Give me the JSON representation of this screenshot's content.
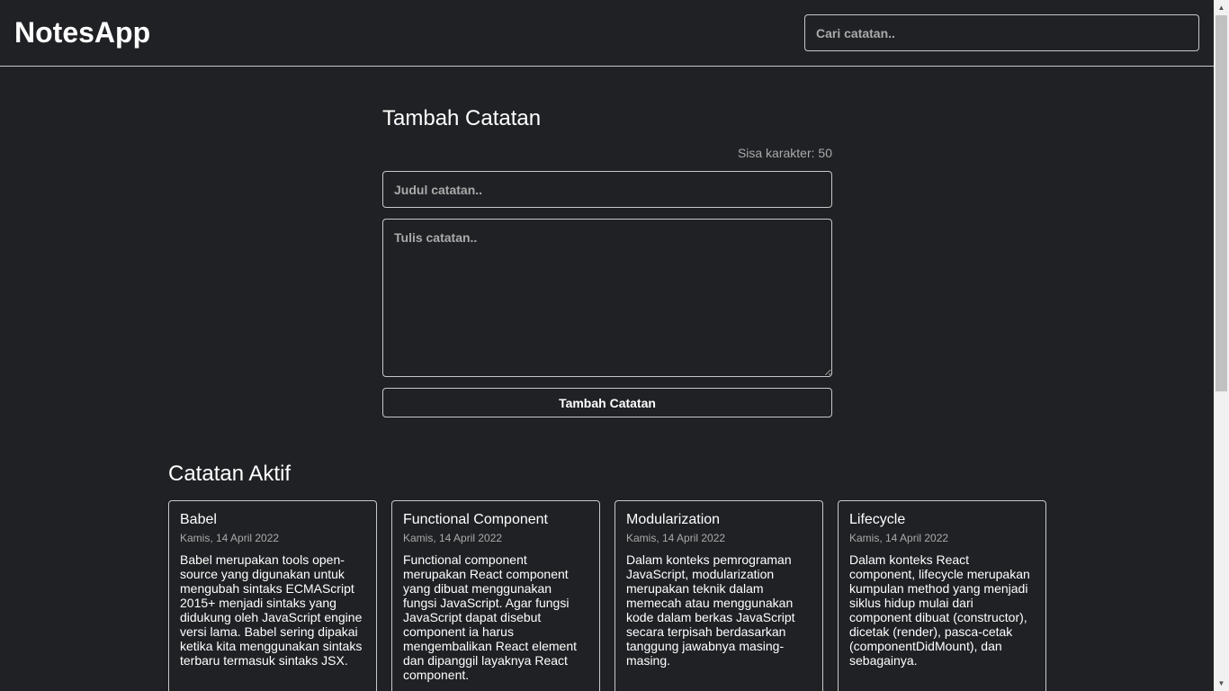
{
  "header": {
    "brand": "NotesApp",
    "search_placeholder": "Cari catatan.."
  },
  "input_section": {
    "title": "Tambah Catatan",
    "char_limit": "Sisa karakter: 50",
    "title_placeholder": "Judul catatan..",
    "body_placeholder": "Tulis catatan..",
    "submit_label": "Tambah Catatan"
  },
  "active_notes": {
    "title": "Catatan Aktif",
    "items": [
      {
        "title": "Babel",
        "date": "Kamis, 14 April 2022",
        "body": "Babel merupakan tools open-source yang digunakan untuk mengubah sintaks ECMAScript 2015+ menjadi sintaks yang didukung oleh JavaScript engine versi lama. Babel sering dipakai ketika kita menggunakan sintaks terbaru termasuk sintaks JSX."
      },
      {
        "title": "Functional Component",
        "date": "Kamis, 14 April 2022",
        "body": "Functional component merupakan React component yang dibuat menggunakan fungsi JavaScript. Agar fungsi JavaScript dapat disebut component ia harus mengembalikan React element dan dipanggil layaknya React component."
      },
      {
        "title": "Modularization",
        "date": "Kamis, 14 April 2022",
        "body": "Dalam konteks pemrograman JavaScript, modularization merupakan teknik dalam memecah atau menggunakan kode dalam berkas JavaScript secara terpisah berdasarkan tanggung jawabnya masing-masing."
      },
      {
        "title": "Lifecycle",
        "date": "Kamis, 14 April 2022",
        "body": "Dalam konteks React component, lifecycle merupakan kumpulan method yang menjadi siklus hidup mulai dari component dibuat (constructor), dicetak (render), pasca-cetak (componentDidMount), dan sebagainya."
      }
    ]
  }
}
